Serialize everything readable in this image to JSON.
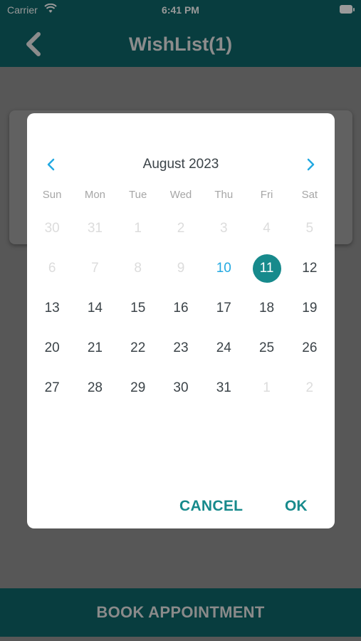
{
  "status_bar": {
    "carrier": "Carrier",
    "time": "6:41 PM"
  },
  "nav": {
    "title": "WishList(1)"
  },
  "calendar": {
    "month_label": "August 2023",
    "weekdays": [
      "Sun",
      "Mon",
      "Tue",
      "Wed",
      "Thu",
      "Fri",
      "Sat"
    ],
    "weeks": [
      [
        "30",
        "31",
        "1",
        "2",
        "3",
        "4",
        "5"
      ],
      [
        "6",
        "7",
        "8",
        "9",
        "10",
        "11",
        "12"
      ],
      [
        "13",
        "14",
        "15",
        "16",
        "17",
        "18",
        "19"
      ],
      [
        "20",
        "21",
        "22",
        "23",
        "24",
        "25",
        "26"
      ],
      [
        "27",
        "28",
        "29",
        "30",
        "31",
        "1",
        "2"
      ]
    ],
    "today": "10",
    "selected": "11",
    "cancel_label": "CANCEL",
    "ok_label": "OK"
  },
  "footer": {
    "book_label": "BOOK APPOINTMENT"
  },
  "colors": {
    "header_bg": "#083d3f",
    "accent": "#178a8c",
    "today": "#23a9e1",
    "overlay": "#575757"
  },
  "icons": {
    "back": "chevron-left-icon",
    "prev": "chevron-left-icon",
    "next": "chevron-right-icon",
    "wifi": "wifi-icon",
    "battery": "battery-icon"
  }
}
